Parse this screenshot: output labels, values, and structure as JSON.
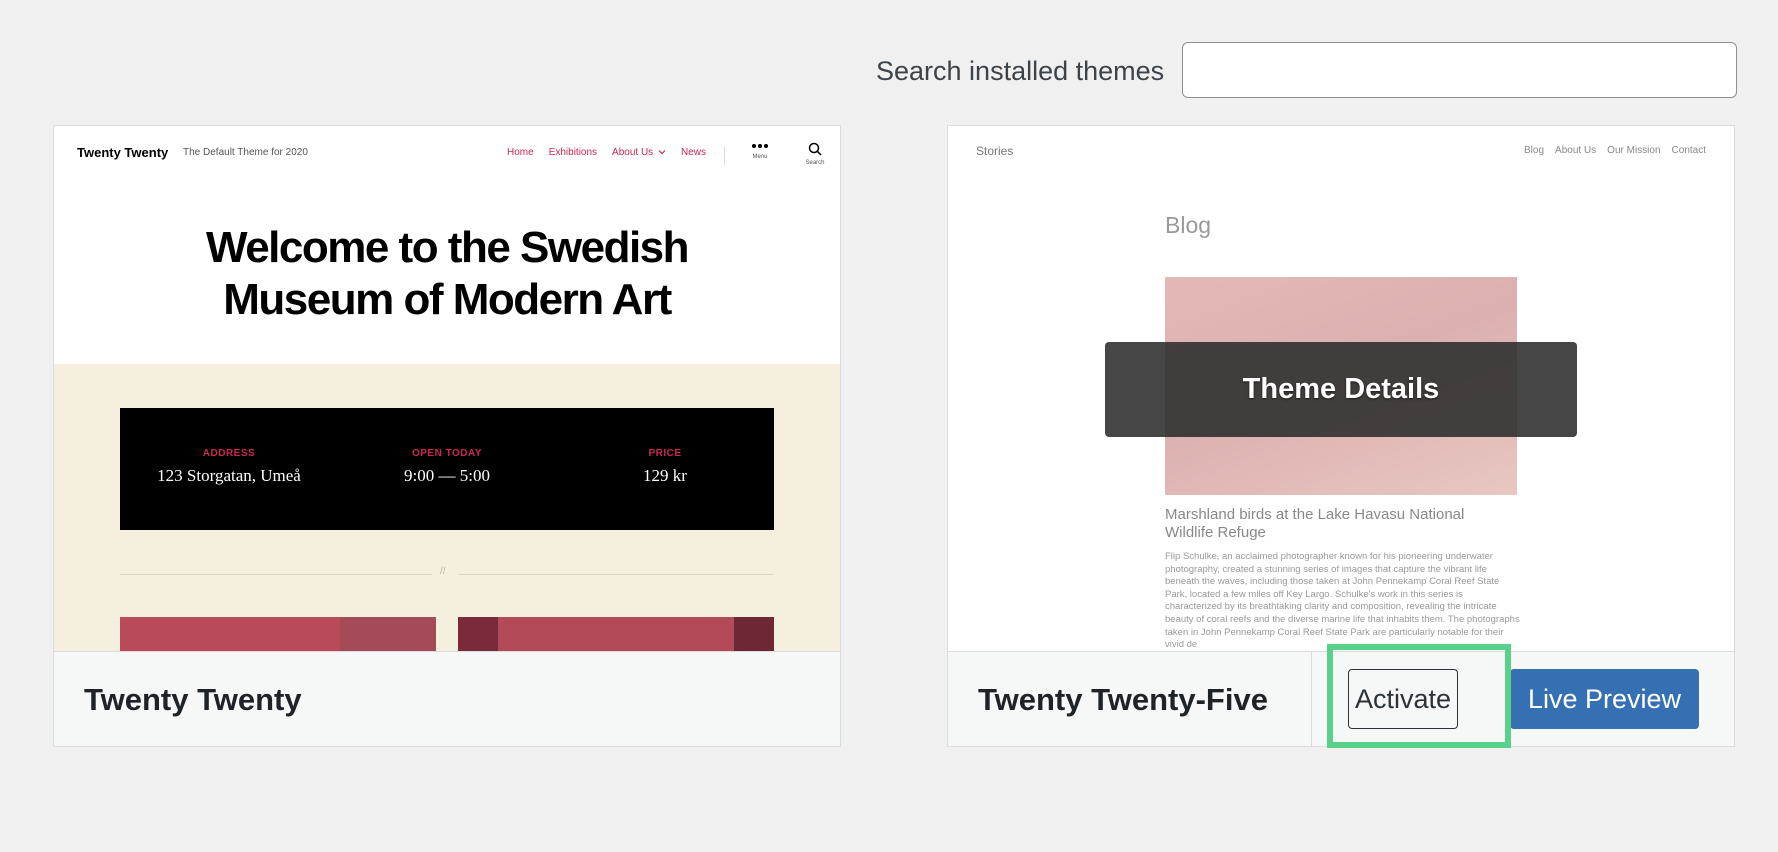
{
  "search": {
    "label": "Search installed themes",
    "value": "",
    "placeholder": ""
  },
  "themes": [
    {
      "name": "Twenty Twenty",
      "preview": {
        "site_title": "Twenty Twenty",
        "tagline": "The Default Theme for 2020",
        "nav": [
          "Home",
          "Exhibitions",
          "About Us",
          "News"
        ],
        "menu_label": "Menu",
        "search_label": "Search",
        "heading_line1": "Welcome to the Swedish",
        "heading_line2": "Museum of Modern Art",
        "info": [
          {
            "label": "ADDRESS",
            "value": "123 Storgatan, Umeå"
          },
          {
            "label": "OPEN TODAY",
            "value": "9:00 — 5:00"
          },
          {
            "label": "PRICE",
            "value": "129 kr"
          }
        ],
        "separator": "//"
      }
    },
    {
      "name": "Twenty Twenty-Five",
      "preview": {
        "site_title": "Stories",
        "nav": [
          "Blog",
          "About Us",
          "Our Mission",
          "Contact"
        ],
        "page_title": "Blog",
        "post_title": "Marshland birds at the Lake Havasu National Wildlife Refuge",
        "post_excerpt": "Flip Schulke, an acclaimed photographer known for his pioneering underwater photography, created a stunning series of images that capture the vibrant life beneath the waves, including those taken at John Pennekamp Coral Reef State Park, located a few miles off Key Largo. Schulke's work in this series is characterized by its breathtaking clarity and composition, revealing the intricate beauty of coral reefs and the diverse marine life that inhabits them. The photographs taken in John Pennekamp Coral Reef State Park are particularly notable for their vivid de"
      },
      "overlay_label": "Theme Details",
      "activate_label": "Activate",
      "live_preview_label": "Live Preview"
    }
  ],
  "colors": {
    "background": "#f0f0f1",
    "accent_tt": "#cd2653",
    "primary_button": "#3570b3",
    "highlight": "#5ad18a"
  },
  "icons": [
    "more-horizontal-icon",
    "search-icon",
    "chevron-down-icon"
  ]
}
